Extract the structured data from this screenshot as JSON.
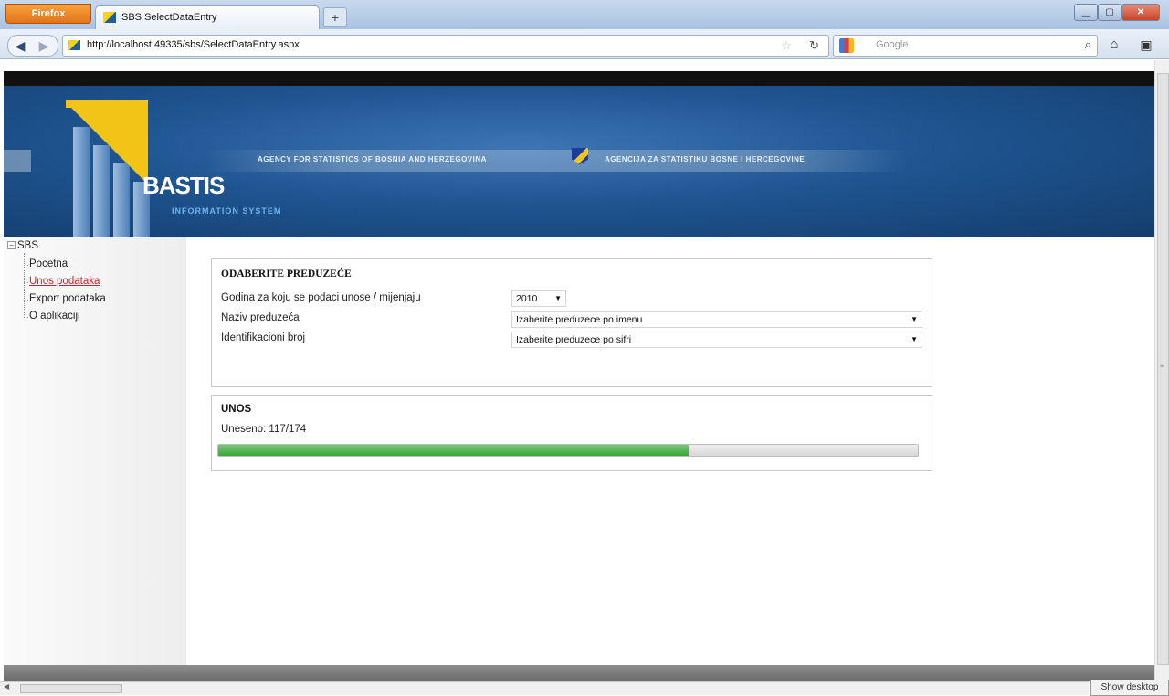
{
  "browser": {
    "app_button": "Firefox",
    "tab_title": "SBS SelectDataEntry",
    "new_tab": "+",
    "url": "http://localhost:49335/sbs/SelectDataEntry.aspx",
    "search_placeholder": "Google",
    "show_desktop": "Show desktop"
  },
  "banner": {
    "logo_text": "BASTIS",
    "logo_subtext": "INFORMATION SYSTEM",
    "agency_en": "AGENCY FOR STATISTICS OF BOSNIA AND HERZEGOVINA",
    "agency_ba": "AGENCIJA ZA STATISTIKU BOSNE I HERCEGOVINE"
  },
  "sidebar": {
    "root": "SBS",
    "items": [
      {
        "label": "Pocetna",
        "active": false
      },
      {
        "label": "Unos podataka",
        "active": true
      },
      {
        "label": "Export podataka",
        "active": false
      },
      {
        "label": "O aplikaciji",
        "active": false
      }
    ]
  },
  "select_company": {
    "title": "ODABERITE PREDUZEĆE",
    "year_label": "Godina za koju se podaci unose / mijenjaju",
    "year_value": "2010",
    "name_label": "Naziv preduzeća",
    "name_value": "Izaberite preduzece po imenu",
    "id_label": "Identifikacioni broj",
    "id_value": "Izaberite preduzece po sifri"
  },
  "entry": {
    "title": "UNOS",
    "status": "Uneseno: 117/174",
    "entered": 117,
    "total": 174,
    "progress_fraction": 0.672
  },
  "colors": {
    "banner_blue": "#1f5591",
    "logo_yellow": "#f2c418",
    "progress_green": "#3aa33a",
    "active_link": "#c2272d"
  }
}
